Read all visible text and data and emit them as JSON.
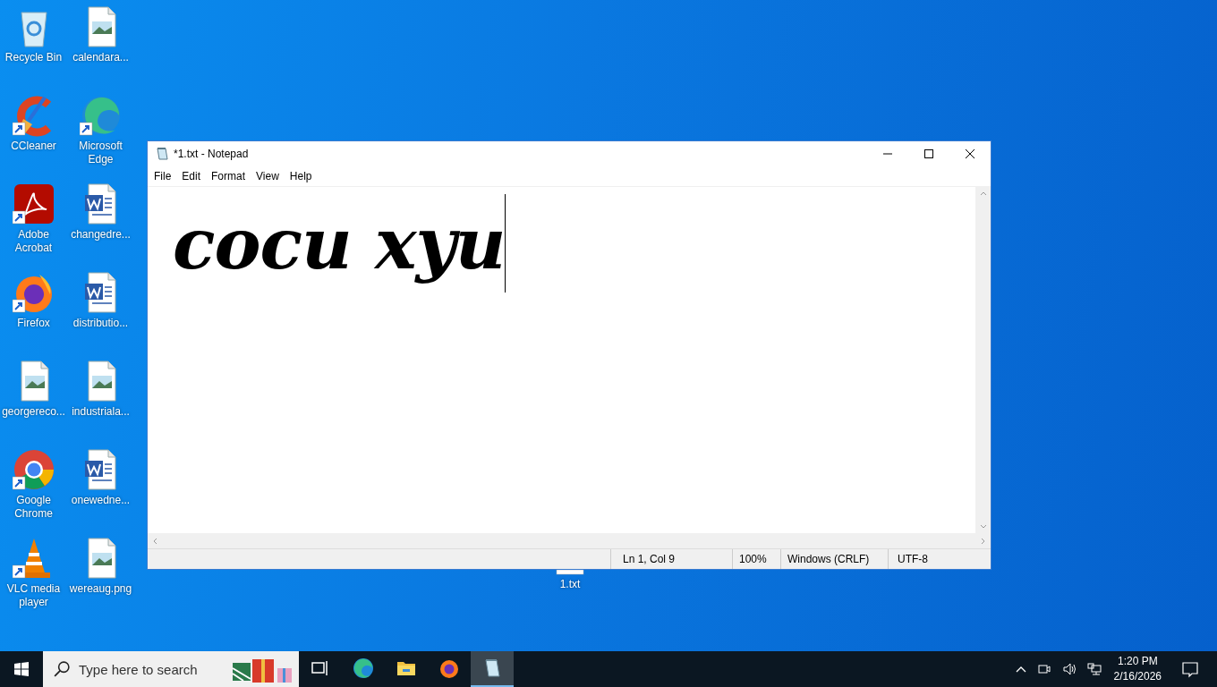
{
  "desktop": {
    "icons": [
      {
        "label": "Recycle Bin",
        "kind": "recycle",
        "shortcut": false
      },
      {
        "label": "calendara...",
        "kind": "image",
        "shortcut": false
      },
      {
        "label": "CCleaner",
        "kind": "ccleaner",
        "shortcut": true
      },
      {
        "label": "Microsoft Edge",
        "kind": "edge",
        "shortcut": true
      },
      {
        "label": "Adobe Acrobat",
        "kind": "acrobat",
        "shortcut": true
      },
      {
        "label": "changedre...",
        "kind": "word",
        "shortcut": false
      },
      {
        "label": "Firefox",
        "kind": "firefox",
        "shortcut": true
      },
      {
        "label": "distributio...",
        "kind": "word",
        "shortcut": false
      },
      {
        "label": "georgereco...",
        "kind": "image",
        "shortcut": false
      },
      {
        "label": "industriala...",
        "kind": "image",
        "shortcut": false
      },
      {
        "label": "Google Chrome",
        "kind": "chrome",
        "shortcut": true
      },
      {
        "label": "onewedne...",
        "kind": "word",
        "shortcut": false
      },
      {
        "label": "VLC media player",
        "kind": "vlc",
        "shortcut": true
      },
      {
        "label": "wereaug.png",
        "kind": "image",
        "shortcut": false
      }
    ],
    "hidden_icon": {
      "label": "1.txt"
    }
  },
  "window": {
    "title": "*1.txt - Notepad",
    "menu": [
      "File",
      "Edit",
      "Format",
      "View",
      "Help"
    ],
    "text": "cocu xyu",
    "status_bar": [
      "Ln 1, Col 9",
      "100%",
      "Windows (CRLF)",
      "UTF-8"
    ]
  },
  "taskbar": {
    "search": {
      "placeholder": "Type here to search"
    },
    "apps": [
      {
        "kind": "taskview",
        "selected": false
      },
      {
        "kind": "edge",
        "selected": false
      },
      {
        "kind": "folder",
        "selected": false
      },
      {
        "kind": "firefox",
        "selected": false
      },
      {
        "kind": "notepad",
        "selected": true
      }
    ],
    "time": "1:20 PM",
    "date": "2/16/2026"
  }
}
